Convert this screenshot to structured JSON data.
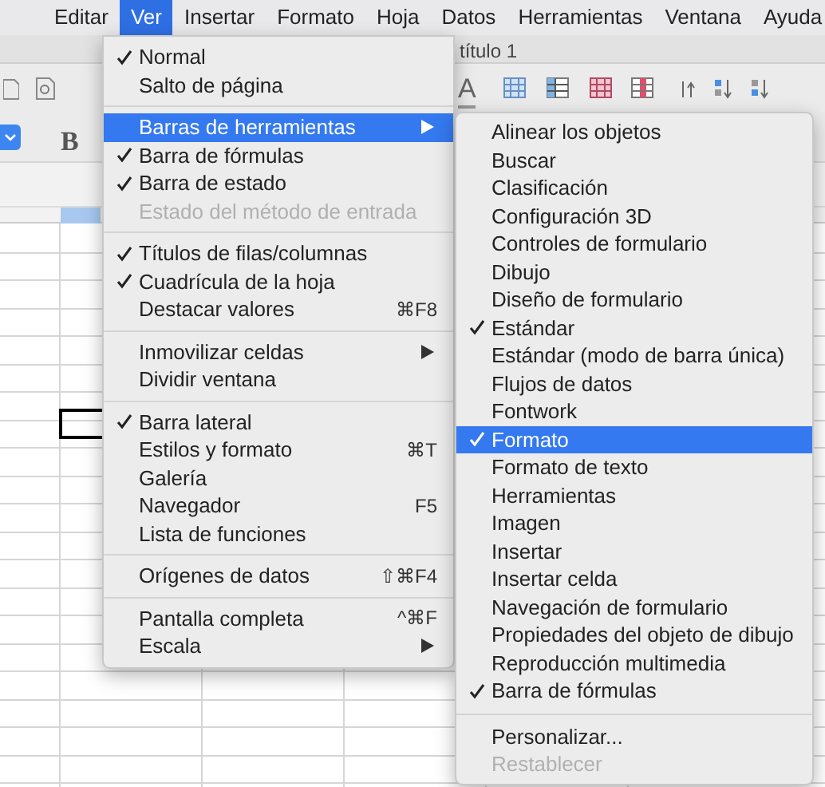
{
  "menubar": {
    "items": [
      {
        "label": "Editar",
        "selected": false
      },
      {
        "label": "Ver",
        "selected": true
      },
      {
        "label": "Insertar",
        "selected": false
      },
      {
        "label": "Formato",
        "selected": false
      },
      {
        "label": "Hoja",
        "selected": false
      },
      {
        "label": "Datos",
        "selected": false
      },
      {
        "label": "Herramientas",
        "selected": false
      },
      {
        "label": "Ventana",
        "selected": false
      },
      {
        "label": "Ayuda",
        "selected": false
      }
    ]
  },
  "window": {
    "title": "título 1"
  },
  "toolbar": {
    "font_color_label": "A",
    "bold_label": "B"
  },
  "view_menu": {
    "items": [
      {
        "kind": "item",
        "label": "Normal",
        "checked": true,
        "disabled": false,
        "selected": false,
        "submenu": false
      },
      {
        "kind": "item",
        "label": "Salto de página",
        "checked": false,
        "disabled": false,
        "selected": false,
        "submenu": false
      },
      {
        "kind": "separator"
      },
      {
        "kind": "item",
        "label": "Barras de herramientas",
        "checked": false,
        "disabled": false,
        "selected": true,
        "submenu": true
      },
      {
        "kind": "item",
        "label": "Barra de fórmulas",
        "checked": true,
        "disabled": false,
        "selected": false,
        "submenu": false
      },
      {
        "kind": "item",
        "label": "Barra de estado",
        "checked": true,
        "disabled": false,
        "selected": false,
        "submenu": false
      },
      {
        "kind": "item",
        "label": "Estado del método de entrada",
        "checked": false,
        "disabled": true,
        "selected": false,
        "submenu": false
      },
      {
        "kind": "separator"
      },
      {
        "kind": "item",
        "label": "Títulos de filas/columnas",
        "checked": true,
        "disabled": false,
        "selected": false,
        "submenu": false
      },
      {
        "kind": "item",
        "label": "Cuadrícula de la hoja",
        "checked": true,
        "disabled": false,
        "selected": false,
        "submenu": false
      },
      {
        "kind": "item",
        "label": "Destacar valores",
        "shortcut": "⌘F8",
        "checked": false,
        "disabled": false,
        "selected": false,
        "submenu": false
      },
      {
        "kind": "separator"
      },
      {
        "kind": "item",
        "label": "Inmovilizar celdas",
        "checked": false,
        "disabled": false,
        "selected": false,
        "submenu": true
      },
      {
        "kind": "item",
        "label": "Dividir ventana",
        "checked": false,
        "disabled": false,
        "selected": false,
        "submenu": false
      },
      {
        "kind": "separator"
      },
      {
        "kind": "item",
        "label": "Barra lateral",
        "checked": true,
        "disabled": false,
        "selected": false,
        "submenu": false
      },
      {
        "kind": "item",
        "label": "Estilos y formato",
        "shortcut": "⌘T",
        "checked": false,
        "disabled": false,
        "selected": false,
        "submenu": false
      },
      {
        "kind": "item",
        "label": "Galería",
        "checked": false,
        "disabled": false,
        "selected": false,
        "submenu": false
      },
      {
        "kind": "item",
        "label": "Navegador",
        "shortcut": "F5",
        "checked": false,
        "disabled": false,
        "selected": false,
        "submenu": false
      },
      {
        "kind": "item",
        "label": "Lista de funciones",
        "checked": false,
        "disabled": false,
        "selected": false,
        "submenu": false
      },
      {
        "kind": "separator"
      },
      {
        "kind": "item",
        "label": "Orígenes de datos",
        "shortcut": "⇧⌘F4",
        "checked": false,
        "disabled": false,
        "selected": false,
        "submenu": false
      },
      {
        "kind": "separator"
      },
      {
        "kind": "item",
        "label": "Pantalla completa",
        "shortcut": "^⌘F",
        "checked": false,
        "disabled": false,
        "selected": false,
        "submenu": false
      },
      {
        "kind": "item",
        "label": "Escala",
        "checked": false,
        "disabled": false,
        "selected": false,
        "submenu": true
      }
    ]
  },
  "toolbars_submenu": {
    "items": [
      {
        "kind": "item",
        "label": "Alinear los objetos",
        "checked": false,
        "disabled": false,
        "selected": false
      },
      {
        "kind": "item",
        "label": "Buscar",
        "checked": false,
        "disabled": false,
        "selected": false
      },
      {
        "kind": "item",
        "label": "Clasificación",
        "checked": false,
        "disabled": false,
        "selected": false
      },
      {
        "kind": "item",
        "label": "Configuración 3D",
        "checked": false,
        "disabled": false,
        "selected": false
      },
      {
        "kind": "item",
        "label": "Controles de formulario",
        "checked": false,
        "disabled": false,
        "selected": false
      },
      {
        "kind": "item",
        "label": "Dibujo",
        "checked": false,
        "disabled": false,
        "selected": false
      },
      {
        "kind": "item",
        "label": "Diseño de formulario",
        "checked": false,
        "disabled": false,
        "selected": false
      },
      {
        "kind": "item",
        "label": "Estándar",
        "checked": true,
        "disabled": false,
        "selected": false
      },
      {
        "kind": "item",
        "label": "Estándar (modo de barra única)",
        "checked": false,
        "disabled": false,
        "selected": false
      },
      {
        "kind": "item",
        "label": "Flujos de datos",
        "checked": false,
        "disabled": false,
        "selected": false
      },
      {
        "kind": "item",
        "label": "Fontwork",
        "checked": false,
        "disabled": false,
        "selected": false
      },
      {
        "kind": "item",
        "label": "Formato",
        "checked": true,
        "disabled": false,
        "selected": true
      },
      {
        "kind": "item",
        "label": "Formato de texto",
        "checked": false,
        "disabled": false,
        "selected": false
      },
      {
        "kind": "item",
        "label": "Herramientas",
        "checked": false,
        "disabled": false,
        "selected": false
      },
      {
        "kind": "item",
        "label": "Imagen",
        "checked": false,
        "disabled": false,
        "selected": false
      },
      {
        "kind": "item",
        "label": "Insertar",
        "checked": false,
        "disabled": false,
        "selected": false
      },
      {
        "kind": "item",
        "label": "Insertar celda",
        "checked": false,
        "disabled": false,
        "selected": false
      },
      {
        "kind": "item",
        "label": "Navegación de formulario",
        "checked": false,
        "disabled": false,
        "selected": false
      },
      {
        "kind": "item",
        "label": "Propiedades del objeto de dibujo",
        "checked": false,
        "disabled": false,
        "selected": false
      },
      {
        "kind": "item",
        "label": "Reproducción multimedia",
        "checked": false,
        "disabled": false,
        "selected": false
      },
      {
        "kind": "item",
        "label": "Barra de fórmulas",
        "checked": true,
        "disabled": false,
        "selected": false
      },
      {
        "kind": "separator"
      },
      {
        "kind": "item",
        "label": "Personalizar...",
        "checked": false,
        "disabled": false,
        "selected": false
      },
      {
        "kind": "item",
        "label": "Restablecer",
        "checked": false,
        "disabled": true,
        "selected": false
      }
    ]
  }
}
